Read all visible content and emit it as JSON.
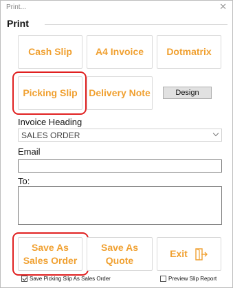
{
  "window": {
    "title": "Print..."
  },
  "print_group": {
    "label": "Print"
  },
  "buttons": {
    "cash_slip": "Cash Slip",
    "a4_invoice": "A4 Invoice",
    "dotmatrix": "Dotmatrix",
    "picking_slip": "Picking Slip",
    "delivery_note": "Delivery Note",
    "design": "Design",
    "save_as_sales_order_line1": "Save As",
    "save_as_sales_order_line2": "Sales Order",
    "save_as_quote_line1": "Save As",
    "save_as_quote_line2": "Quote",
    "exit": "Exit"
  },
  "invoice_heading": {
    "label": "Invoice Heading",
    "value": "SALES ORDER"
  },
  "email": {
    "label": "Email",
    "value": ""
  },
  "to": {
    "label": "To:",
    "value": ""
  },
  "options": {
    "save_picking_slip": {
      "label": "Save Picking Slip As Sales Order",
      "checked": true
    },
    "preview_slip_report": {
      "label": "Preview Slip Report",
      "checked": false
    }
  },
  "colors": {
    "accent": "#f0a030",
    "highlight": "#e02020"
  },
  "icons": {
    "close": "close-icon",
    "exit": "exit-door-icon",
    "dropdown": "chevron-down-icon"
  }
}
